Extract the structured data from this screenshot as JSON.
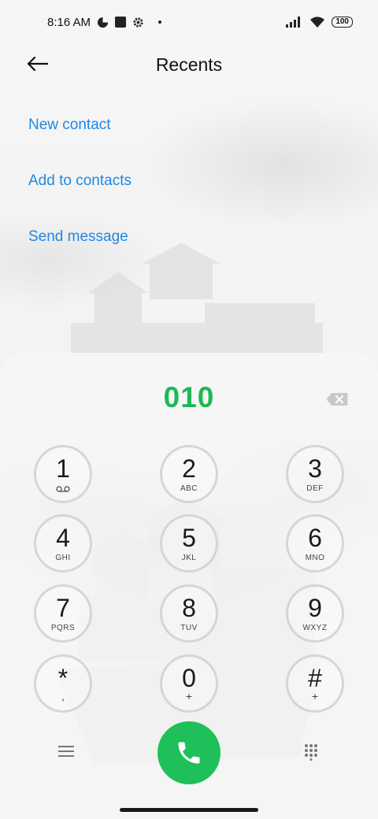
{
  "status_bar": {
    "time": "8:16 AM",
    "battery": "100",
    "icons": [
      "data-saver-icon",
      "square-notification-icon",
      "settings-icon",
      "dot-icon",
      "signal-icon",
      "wifi-icon",
      "battery-icon"
    ]
  },
  "header": {
    "title": "Recents",
    "back_icon": "arrow-left-icon"
  },
  "actions": {
    "new_contact": "New contact",
    "add_to_contacts": "Add to contacts",
    "send_message": "Send message"
  },
  "dialer": {
    "number": "010",
    "backspace_icon": "backspace-icon",
    "keys": [
      {
        "digit": "1",
        "letters": "",
        "sub_icon": "voicemail-icon"
      },
      {
        "digit": "2",
        "letters": "ABC"
      },
      {
        "digit": "3",
        "letters": "DEF"
      },
      {
        "digit": "4",
        "letters": "GHI"
      },
      {
        "digit": "5",
        "letters": "JKL"
      },
      {
        "digit": "6",
        "letters": "MNO"
      },
      {
        "digit": "7",
        "letters": "PQRS"
      },
      {
        "digit": "8",
        "letters": "TUV"
      },
      {
        "digit": "9",
        "letters": "WXYZ"
      },
      {
        "digit": "*",
        "sub": ","
      },
      {
        "digit": "0",
        "sub": "+"
      },
      {
        "digit": "#",
        "sub": "+"
      }
    ]
  },
  "bottom": {
    "menu_icon": "menu-icon",
    "call_icon": "phone-icon",
    "dialpad_icon": "dialpad-grid-icon"
  },
  "colors": {
    "accent_blue": "#1e88e5",
    "number_green": "#1db954",
    "call_green": "#1fc05a"
  }
}
